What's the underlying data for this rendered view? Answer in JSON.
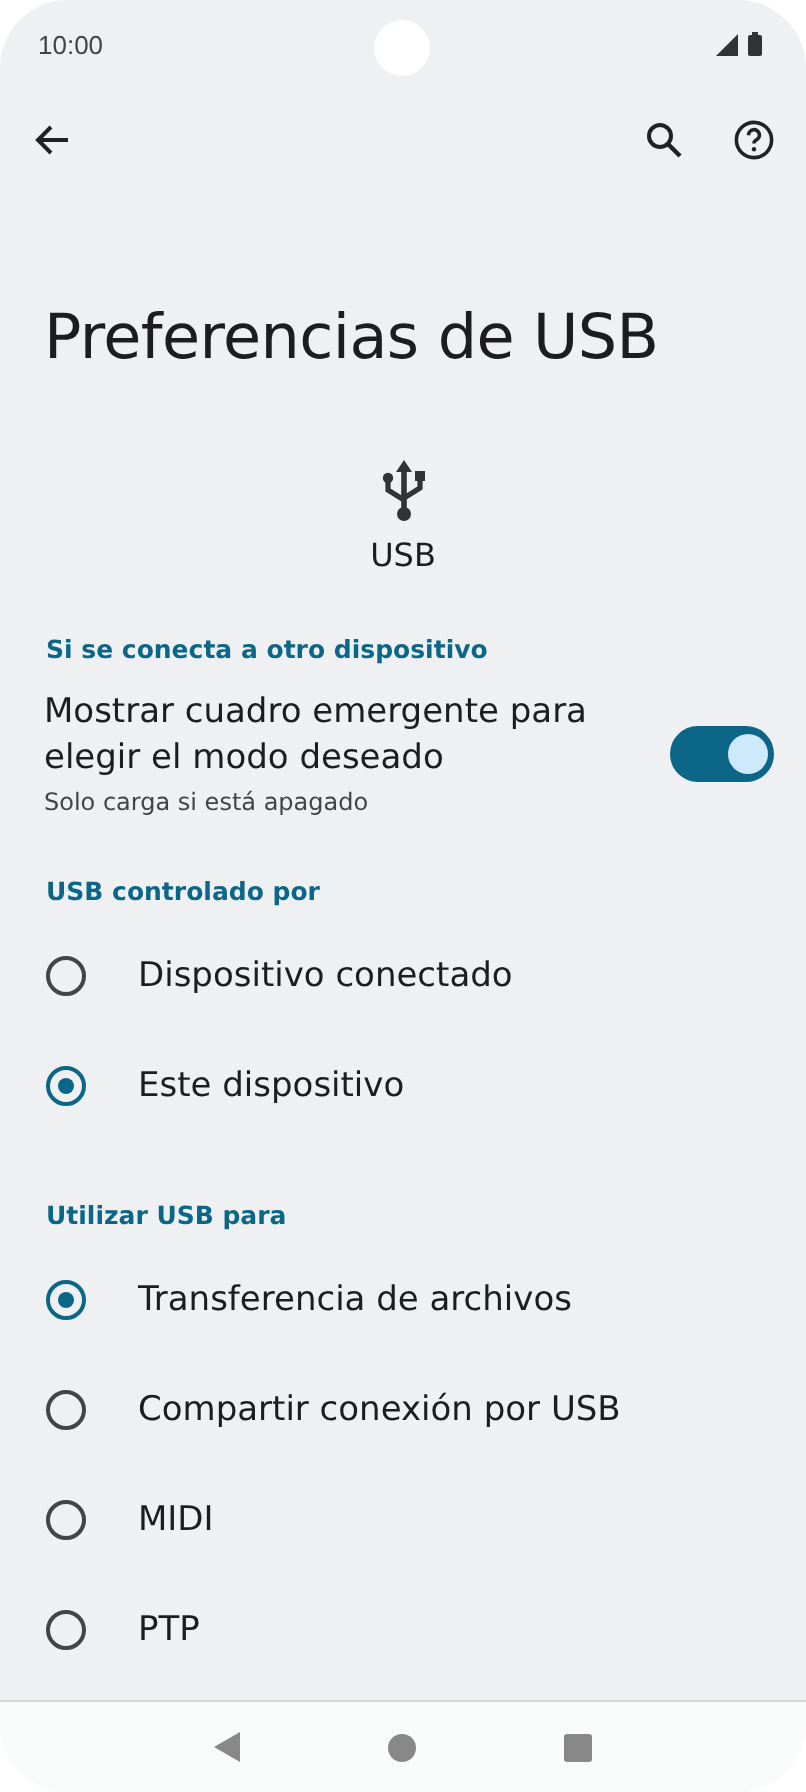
{
  "status_bar": {
    "time": "10:00"
  },
  "title": "Preferencias de USB",
  "device": {
    "label": "USB"
  },
  "sections": [
    {
      "header": "Si se conecta a otro dispositivo",
      "items": [
        {
          "kind": "switch",
          "title": "Mostrar cuadro emergente para elegir el modo deseado",
          "subtitle": "Solo carga si está apagado",
          "on": true
        }
      ]
    },
    {
      "header": "USB controlado por",
      "items": [
        {
          "kind": "radio",
          "title": "Dispositivo conectado",
          "selected": false
        },
        {
          "kind": "radio",
          "title": "Este dispositivo",
          "selected": true
        }
      ]
    },
    {
      "header": "Utilizar USB para",
      "items": [
        {
          "kind": "radio",
          "title": "Transferencia de archivos",
          "selected": true
        },
        {
          "kind": "radio",
          "title": "Compartir conexión por USB",
          "selected": false
        },
        {
          "kind": "radio",
          "title": "MIDI",
          "selected": false
        },
        {
          "kind": "radio",
          "title": "PTP",
          "selected": false
        }
      ]
    }
  ]
}
